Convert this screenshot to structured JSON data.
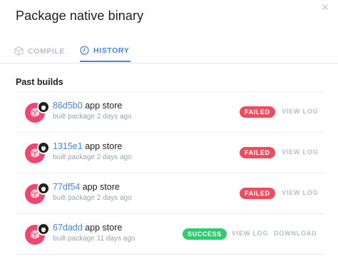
{
  "dialog": {
    "title": "Package native binary",
    "close_glyph": "×",
    "tabs": [
      {
        "label": "COMPILE",
        "icon": "box-icon",
        "active": false
      },
      {
        "label": "HISTORY",
        "icon": "clock-icon",
        "active": true
      }
    ],
    "section_title": "Past builds",
    "builds": [
      {
        "hash": "86d5b0",
        "target": "app store",
        "subtitle": "built package 2 days ago",
        "status": "FAILED",
        "actions": [
          "VIEW LOG"
        ]
      },
      {
        "hash": "1315e1",
        "target": "app store",
        "subtitle": "built package 2 days ago",
        "status": "FAILED",
        "actions": [
          "VIEW LOG"
        ]
      },
      {
        "hash": "77df54",
        "target": "app store",
        "subtitle": "built package 2 days ago",
        "status": "FAILED",
        "actions": [
          "VIEW LOG"
        ]
      },
      {
        "hash": "67dadd",
        "target": "app store",
        "subtitle": "built package 11 days ago",
        "status": "SUCCESS",
        "actions": [
          "VIEW LOG",
          "DOWNLOAD"
        ]
      }
    ]
  },
  "colors": {
    "accent": "#3f88e8",
    "failed": "#ef4c5f",
    "success": "#2ecb70",
    "avatar": "#f2456f"
  }
}
